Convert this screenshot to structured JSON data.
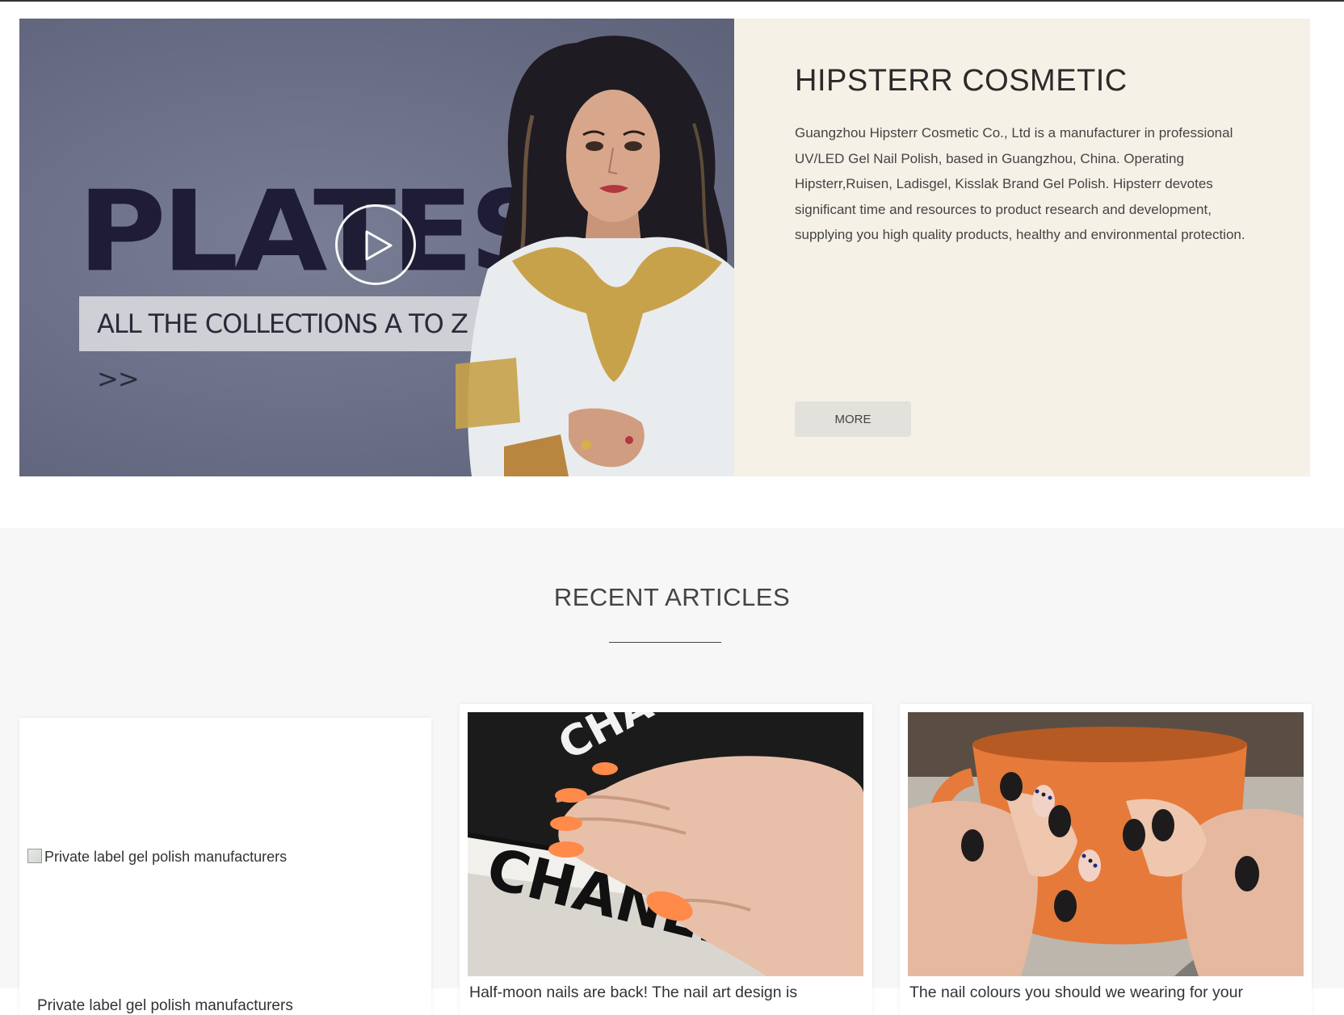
{
  "hero": {
    "video": {
      "headline": "PLATES",
      "banner": "ALL THE COLLECTIONS A TO Z >>"
    },
    "title": "HIPSTERR COSMETIC",
    "description": "Guangzhou Hipsterr Cosmetic Co., Ltd is a manufacturer in professional UV/LED Gel Nail Polish, based in Guangzhou, China. Operating Hipsterr,Ruisen, Ladisgel, Kisslak Brand Gel Polish. Hipsterr devotes significant time and resources to product research and development, supplying you high quality products, healthy and environmental protection.",
    "more_label": "MORE"
  },
  "articles": {
    "title": "RECENT ARTICLES",
    "items": [
      {
        "image_alt": "Private label gel polish manufacturers",
        "title": "Private label gel polish manufacturers"
      },
      {
        "title": "Half-moon nails are back! The nail art design is"
      },
      {
        "title": "The nail colours you should we wearing for your"
      }
    ]
  },
  "colors": {
    "hero_info_bg": "#f6f1e7",
    "video_bg": "#6a6e86",
    "section_bg": "#f7f7f7",
    "button_bg": "#e3e1dc"
  }
}
